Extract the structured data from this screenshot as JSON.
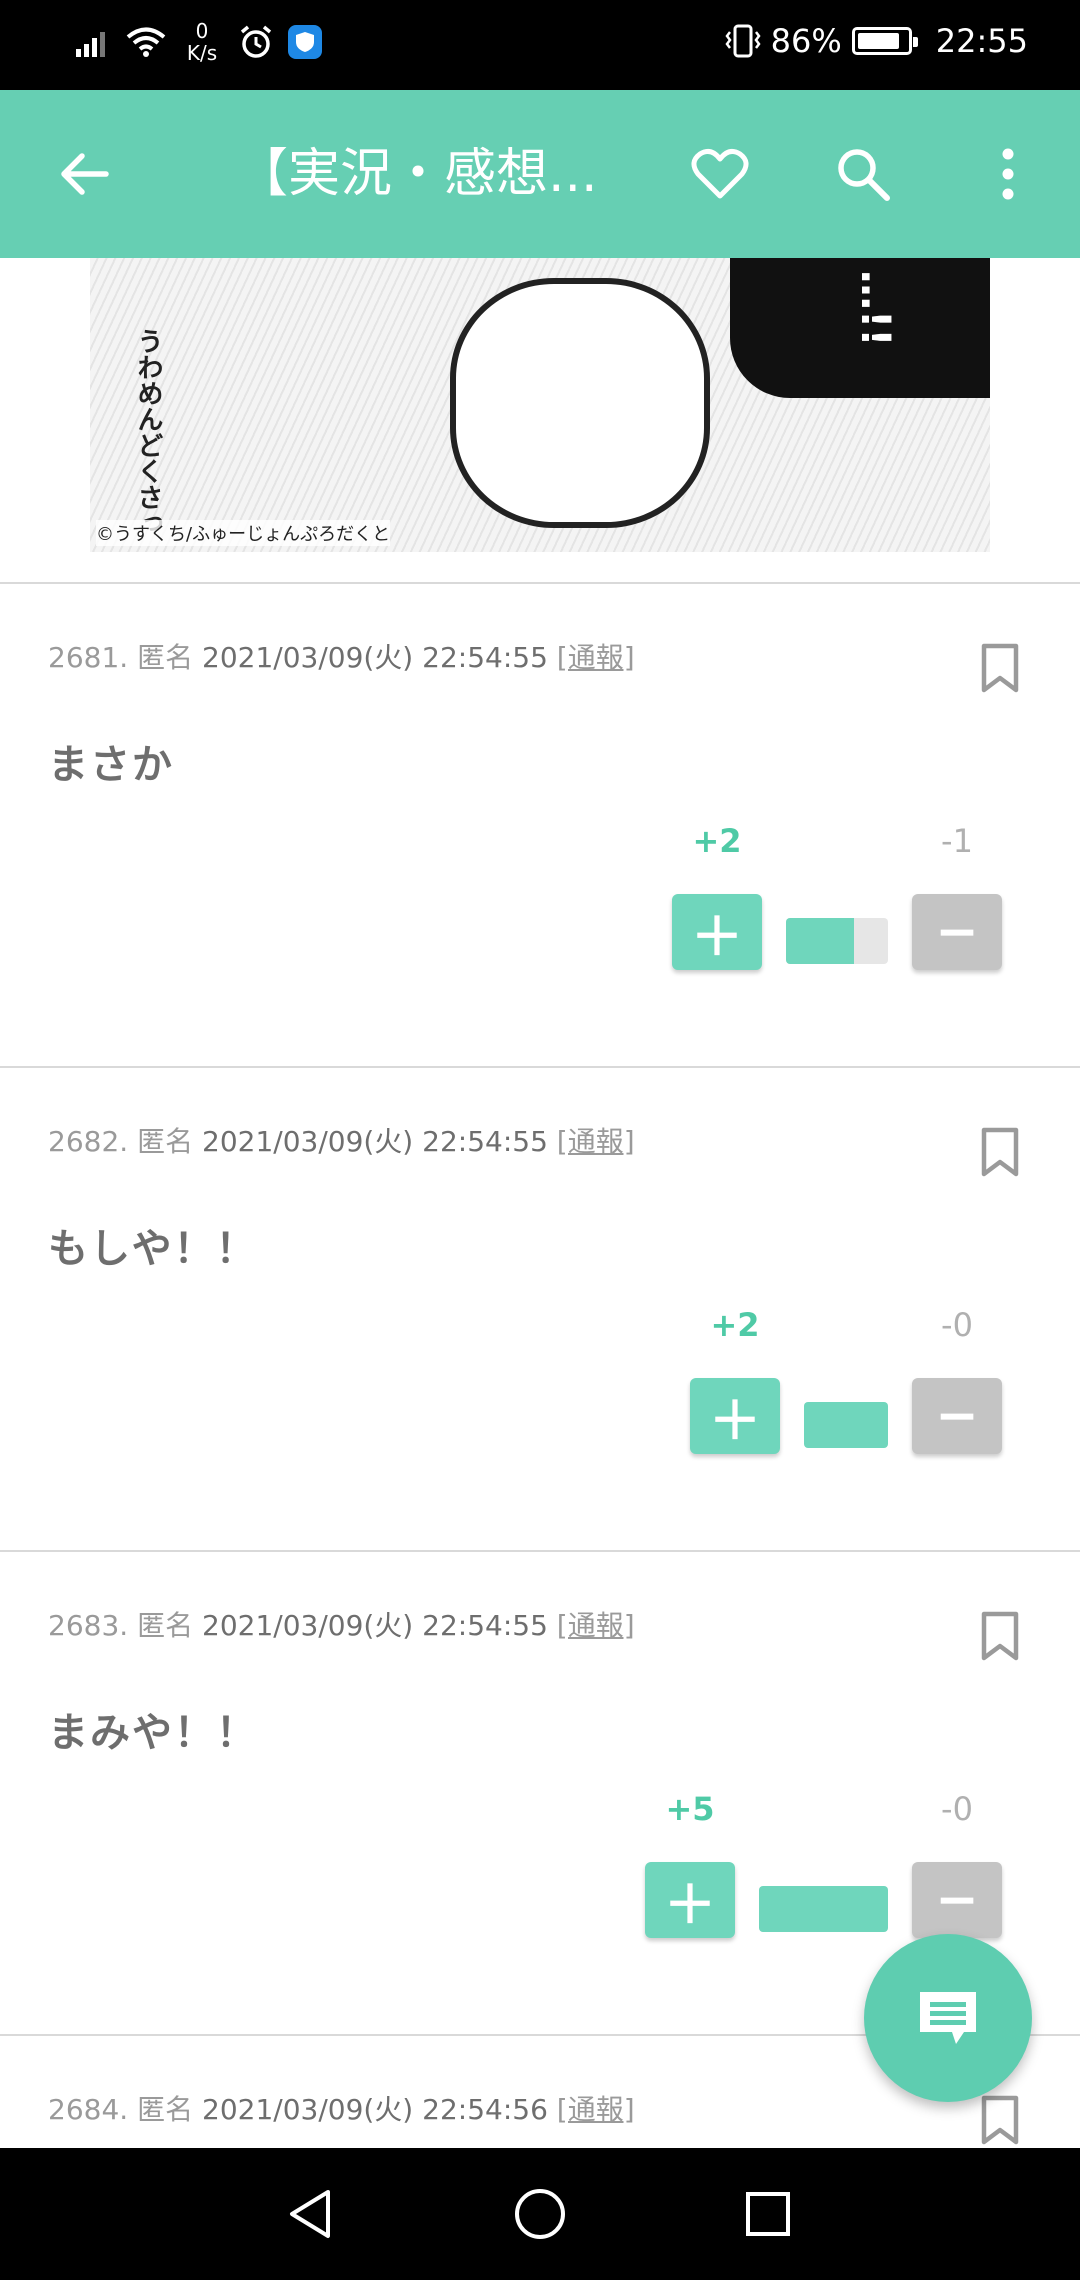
{
  "status_bar": {
    "net_speed_value": "0",
    "net_speed_unit": "K/s",
    "battery": "86%",
    "battery_level": 0.86,
    "time": "22:55"
  },
  "app_bar": {
    "title": "【実況・感想..."
  },
  "manga": {
    "copyright": "©うすくち/ふゅーじょんぷろだくと",
    "vertical_text": "うわめんどくさっ",
    "exclaim": "…!!"
  },
  "comments": [
    {
      "number": "2681.",
      "author": "匿名",
      "date": "2021/03/09(火) 22:54:55",
      "report": "[通報]",
      "text": "まさか",
      "plus": "+2",
      "minus": "-1",
      "ratio": 0.67
    },
    {
      "number": "2682.",
      "author": "匿名",
      "date": "2021/03/09(火) 22:54:55",
      "report": "[通報]",
      "text": "もしや！！",
      "plus": "+2",
      "minus": "-0",
      "ratio": 1.0
    },
    {
      "number": "2683.",
      "author": "匿名",
      "date": "2021/03/09(火) 22:54:55",
      "report": "[通報]",
      "text": "まみや！！",
      "plus": "+5",
      "minus": "-0",
      "ratio": 1.0
    },
    {
      "number": "2684.",
      "author": "匿名",
      "date": "2021/03/09(火) 22:54:56",
      "report": "[通報]",
      "text": "",
      "plus": "",
      "minus": "",
      "ratio": 0
    }
  ],
  "icons": {
    "back": "arrow-left-icon",
    "favorite": "heart-icon",
    "search": "search-icon",
    "more": "more-vert-icon",
    "bookmark": "bookmark-icon",
    "fab": "comment-icon"
  },
  "colors": {
    "accent": "#66cfb3",
    "vote_up": "#6fd6bc",
    "vote_down": "#c4c4c4"
  }
}
